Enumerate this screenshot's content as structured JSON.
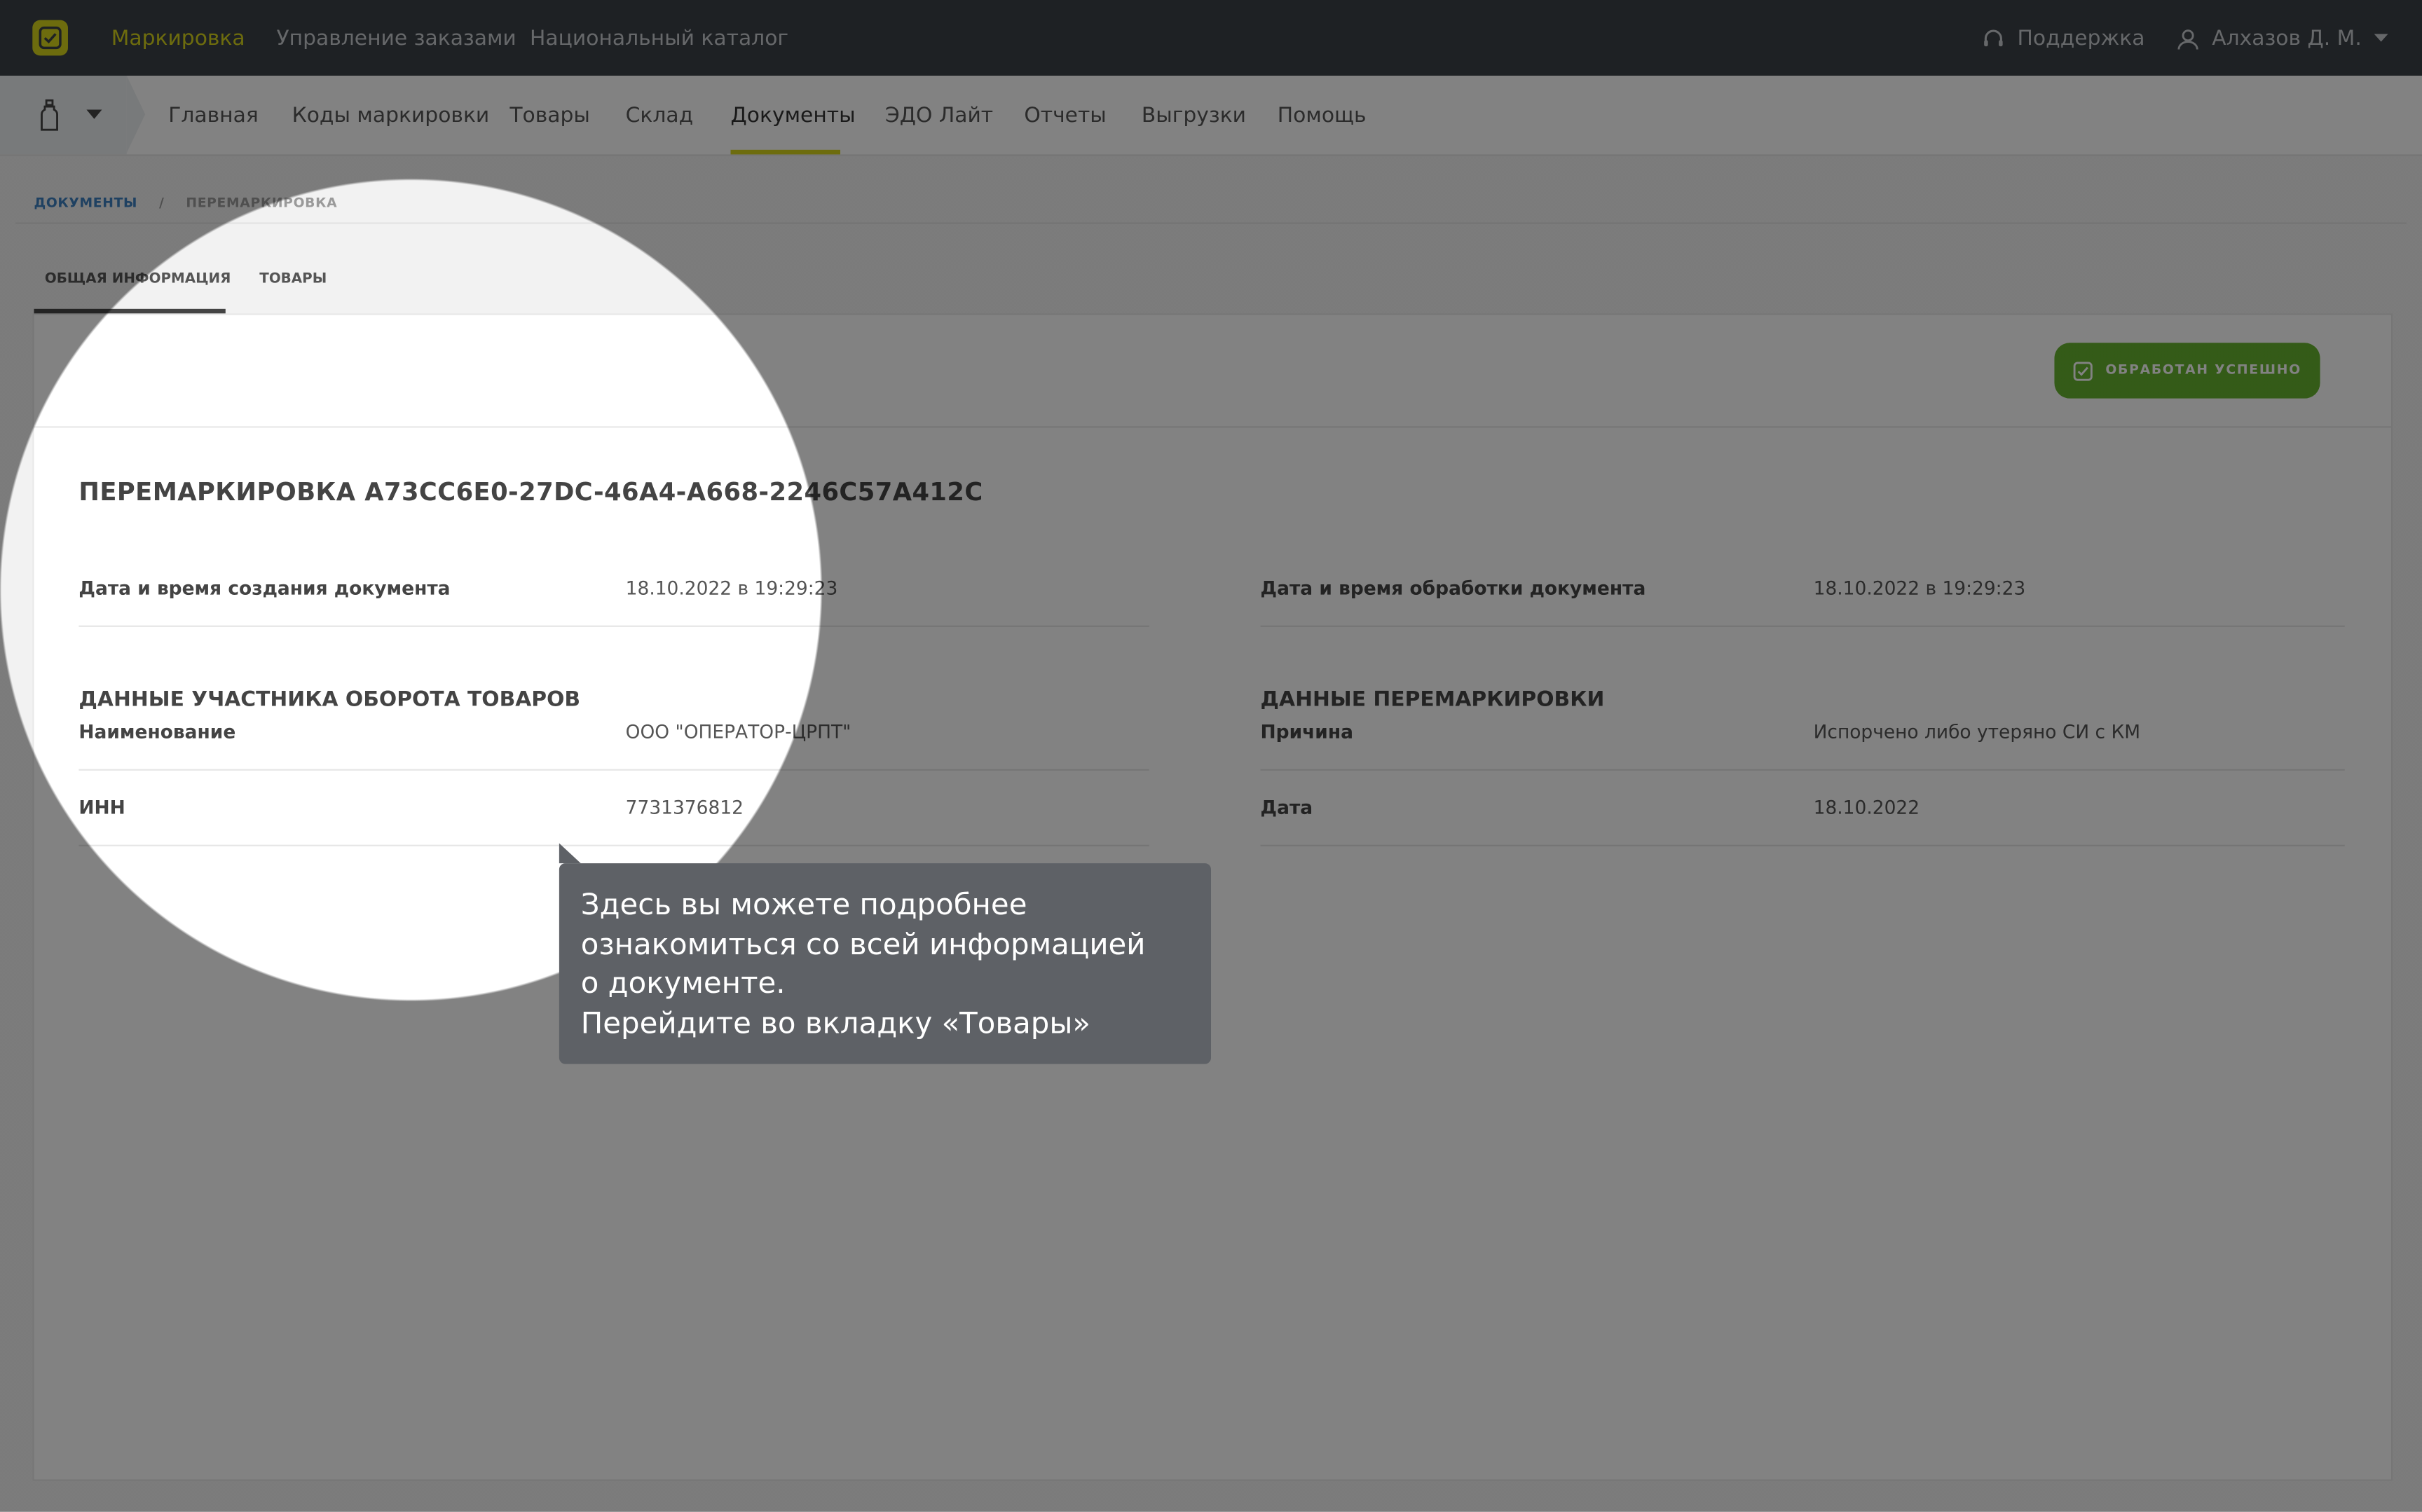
{
  "topbar": {
    "nav": [
      "Маркировка",
      "Управление заказами",
      "Национальный каталог"
    ],
    "support": "Поддержка",
    "user": "Алхазов Д. М."
  },
  "subnav": {
    "items": [
      "Главная",
      "Коды маркировки",
      "Товары",
      "Склад",
      "Документы",
      "ЭДО Лайт",
      "Отчеты",
      "Выгрузки",
      "Помощь"
    ],
    "active": "Документы"
  },
  "breadcrumb": {
    "link": "Документы",
    "separator": "/",
    "current": "Перемаркировка"
  },
  "tabs": [
    "Общая информация",
    "Товары"
  ],
  "status": "Обработан успешно",
  "document": {
    "title": "ПЕРЕМАРКИРОВКА A73CC6E0-27DC-46A4-A668-2246C57A412C",
    "created_label": "Дата и время создания документа",
    "created_value": "18.10.2022 в 19:29:23",
    "processed_label": "Дата и время обработки документа",
    "processed_value": "18.10.2022 в 19:29:23"
  },
  "participant": {
    "title": "ДАННЫЕ УЧАСТНИКА ОБОРОТА ТОВАРОВ",
    "name_label": "Наименование",
    "name_value": "ООО \"ОПЕРАТОР-ЦРПТ\"",
    "inn_label": "ИНН",
    "inn_value": "7731376812"
  },
  "remarking": {
    "title": "ДАННЫЕ ПЕРЕМАРКИРОВКИ",
    "reason_label": "Причина",
    "reason_value": "Испорчено либо утеряно СИ с КМ",
    "date_label": "Дата",
    "date_value": "18.10.2022"
  },
  "tooltip": {
    "lines": [
      "Здесь вы можете подробнее",
      "ознакомиться со всей информацией",
      "о документе.",
      "Перейдите во вкладку «Товары»"
    ]
  },
  "colors": {
    "topbar": "#3b4046",
    "accent": "#d5d31b",
    "status_green": "#65b32e",
    "link": "#3d7fbf"
  }
}
